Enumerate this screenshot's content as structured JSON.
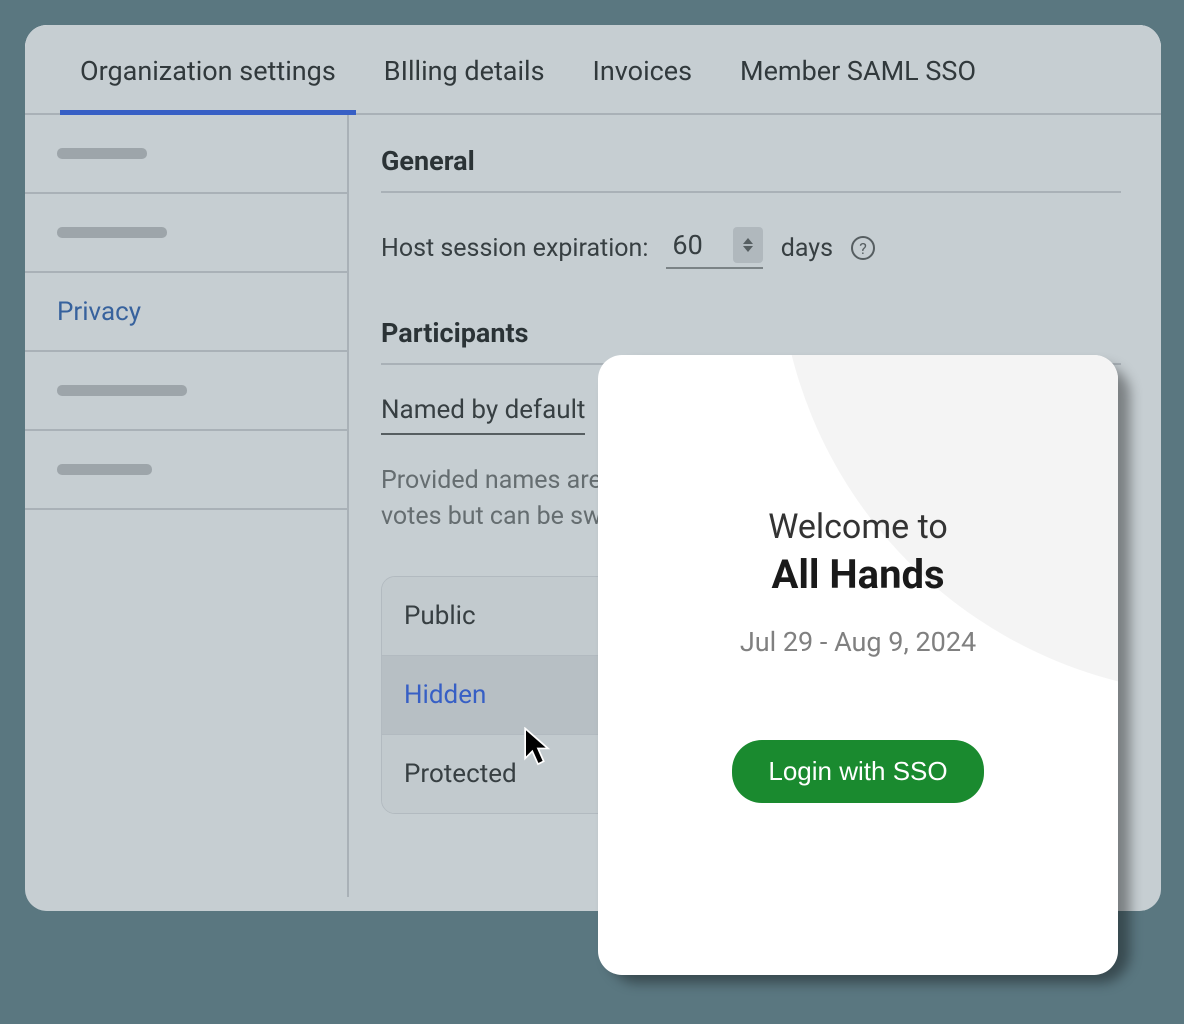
{
  "tabs": [
    {
      "label": "Organization settings",
      "active": true
    },
    {
      "label": "BIlling details"
    },
    {
      "label": "Invoices"
    },
    {
      "label": "Member SAML SSO"
    }
  ],
  "sidebar": {
    "active_label": "Privacy"
  },
  "general": {
    "title": "General",
    "host_session_label": "Host session expiration:",
    "host_session_value": "60",
    "days_label": "days"
  },
  "participants": {
    "title": "Participants",
    "selected": "Named by default",
    "description": "Provided names are used by default when sending poll votes but can be switched to anonymous.",
    "options": [
      "Public",
      "Hidden",
      "Protected"
    ]
  },
  "modal": {
    "welcome": "Welcome to",
    "title": "All Hands",
    "date": "Jul 29 - Aug 9, 2024",
    "button": "Login with SSO"
  }
}
